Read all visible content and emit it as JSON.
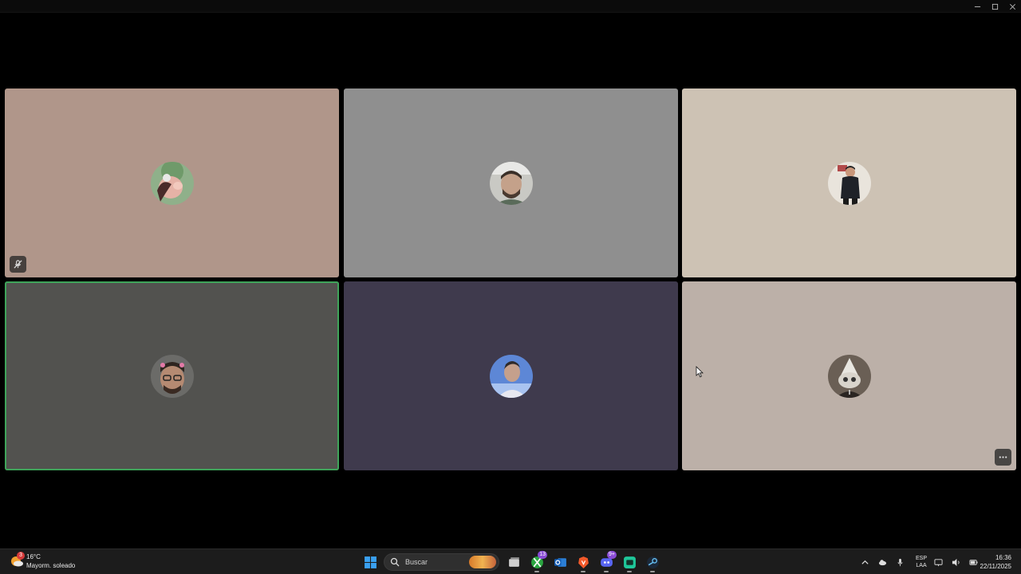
{
  "window": {
    "controls": {
      "minimize_icon": "minimize-icon",
      "maximize_icon": "maximize-icon",
      "close_icon": "close-icon"
    }
  },
  "grid": {
    "tiles": [
      {
        "bg": "#b0968a",
        "avatar": "participant-1-avatar",
        "mic_muted": true
      },
      {
        "bg": "#8f8f8f",
        "avatar": "participant-2-avatar"
      },
      {
        "bg": "#cdc2b4",
        "avatar": "participant-3-avatar"
      },
      {
        "bg": "#52524f",
        "avatar": "participant-4-avatar",
        "active_speaker": true,
        "highlight_color": "#3fa45a"
      },
      {
        "bg": "#3f3a4d",
        "avatar": "participant-5-avatar"
      },
      {
        "bg": "#bcb0a8",
        "avatar": "participant-6-avatar",
        "more_options": true
      }
    ]
  },
  "taskbar": {
    "weather": {
      "temp": "16°C",
      "condition": "Mayorm. soleado",
      "badge": "3"
    },
    "search": {
      "placeholder": "Buscar"
    },
    "apps": [
      {
        "name": "start",
        "icon": "windows-icon"
      },
      {
        "name": "task-view",
        "icon": "task-view-icon"
      },
      {
        "name": "xbox",
        "icon": "xbox-icon",
        "badge": "13"
      },
      {
        "name": "outlook",
        "icon": "outlook-icon"
      },
      {
        "name": "brave",
        "icon": "brave-icon"
      },
      {
        "name": "discord",
        "icon": "discord-icon",
        "badge": "9+"
      },
      {
        "name": "app",
        "icon": "green-app-icon"
      },
      {
        "name": "steam",
        "icon": "steam-icon"
      }
    ],
    "lang": {
      "line1": "ESP",
      "line2": "LAA"
    },
    "clock": {
      "time": "16:36",
      "date": "22/11/2025"
    }
  }
}
